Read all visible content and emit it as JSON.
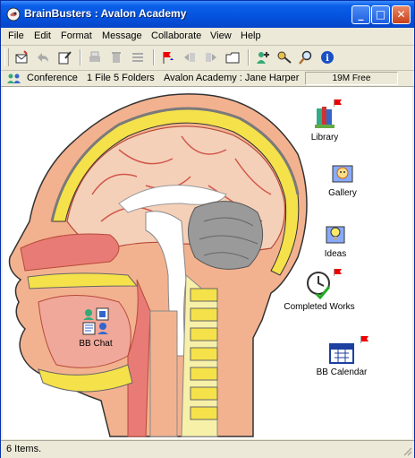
{
  "window": {
    "title": "BrainBusters : Avalon Academy",
    "buttons": {
      "minimize": "_",
      "maximize": "□",
      "close": "✕"
    }
  },
  "menu": [
    "File",
    "Edit",
    "Format",
    "Message",
    "Collaborate",
    "View",
    "Help"
  ],
  "toolbar": {
    "icons": [
      "new-message-icon",
      "reply-icon",
      "edit-icon",
      "print-icon",
      "delete-icon",
      "list-icon",
      "flag-icon",
      "move-left-icon",
      "move-right-icon",
      "folder-icon",
      "add-users-icon",
      "key-icon",
      "search-icon",
      "info-icon"
    ]
  },
  "pathbar": {
    "conference": "Conference",
    "counts": "1 File 5 Folders",
    "location": "Avalon Academy : Jane Harper",
    "free": "19M Free"
  },
  "items": [
    {
      "label": "Library",
      "icon": "library-icon",
      "flag": true
    },
    {
      "label": "Gallery",
      "icon": "gallery-icon",
      "flag": false
    },
    {
      "label": "Ideas",
      "icon": "ideas-icon",
      "flag": false
    },
    {
      "label": "Completed Works",
      "icon": "completed-works-icon",
      "flag": true
    },
    {
      "label": "BB Calendar",
      "icon": "calendar-icon",
      "flag": true
    },
    {
      "label": "BB Chat",
      "icon": "chat-icon",
      "flag": false
    }
  ],
  "status": {
    "text": "6 Items."
  },
  "colors": {
    "title_bar": "#0552dd",
    "flag": "#e00000",
    "background": "#ece9d8"
  }
}
